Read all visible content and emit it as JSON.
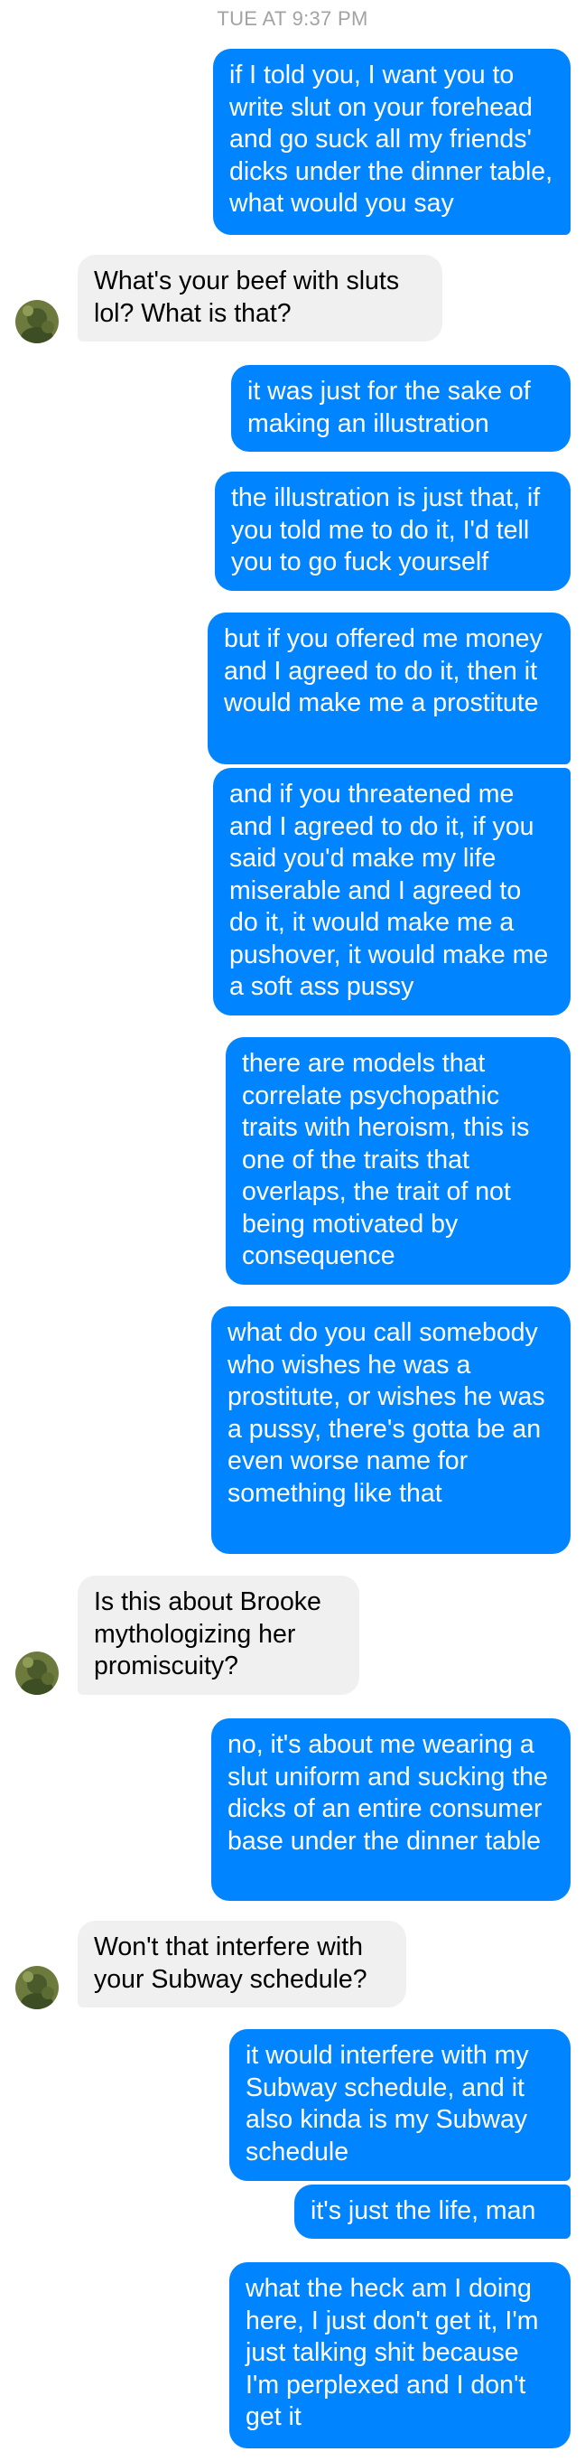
{
  "conversation": {
    "timestamp": "TUE AT 9:37 PM",
    "messages": [
      {
        "sender": "me",
        "text": "if I told you, I want you to write slut on your forehead and go suck all my friends' dicks under the dinner table, what would you say"
      },
      {
        "sender": "them",
        "text": "What's your beef with sluts lol? What is that?"
      },
      {
        "sender": "me",
        "text": "it was just for the sake of making an illustration"
      },
      {
        "sender": "me",
        "text": "the illustration is just that, if you told me to do it, I'd tell you to go fuck yourself"
      },
      {
        "sender": "me",
        "text": "but if you offered me money and I agreed to do it, then it would make me a prostitute"
      },
      {
        "sender": "me",
        "text": "and if you threatened me and I agreed to do it, if you said you'd make my life miserable and I agreed to do it, it would make me a pushover, it would make me a soft ass pussy"
      },
      {
        "sender": "me",
        "text": "there are models that correlate psychopathic traits with heroism, this is one of the traits that overlaps, the trait of not being motivated by consequence"
      },
      {
        "sender": "me",
        "text": "what do you call somebody who wishes he was a prostitute, or wishes he was a pussy, there's gotta be an even worse name for something like that"
      },
      {
        "sender": "them",
        "text": "Is this about Brooke mythologizing her promiscuity?"
      },
      {
        "sender": "me",
        "text": "no, it's about me wearing a slut uniform and sucking the dicks of an entire consumer base under the dinner table"
      },
      {
        "sender": "them",
        "text": "Won't that interfere with your Subway schedule?"
      },
      {
        "sender": "me",
        "text": "it would interfere with my Subway schedule, and it also kinda is my Subway schedule"
      },
      {
        "sender": "me",
        "text": "it's just the life, man"
      },
      {
        "sender": "me",
        "text": "what the heck am I doing here, I just don't get it, I'm just talking shit because I'm perplexed and I don't get it"
      }
    ]
  },
  "colors": {
    "outgoing_bubble": "#0084ff",
    "incoming_bubble": "#f1f0f0",
    "timestamp_text": "#a3a3a3"
  },
  "icons": {
    "avatar": "contact-avatar-photo"
  }
}
